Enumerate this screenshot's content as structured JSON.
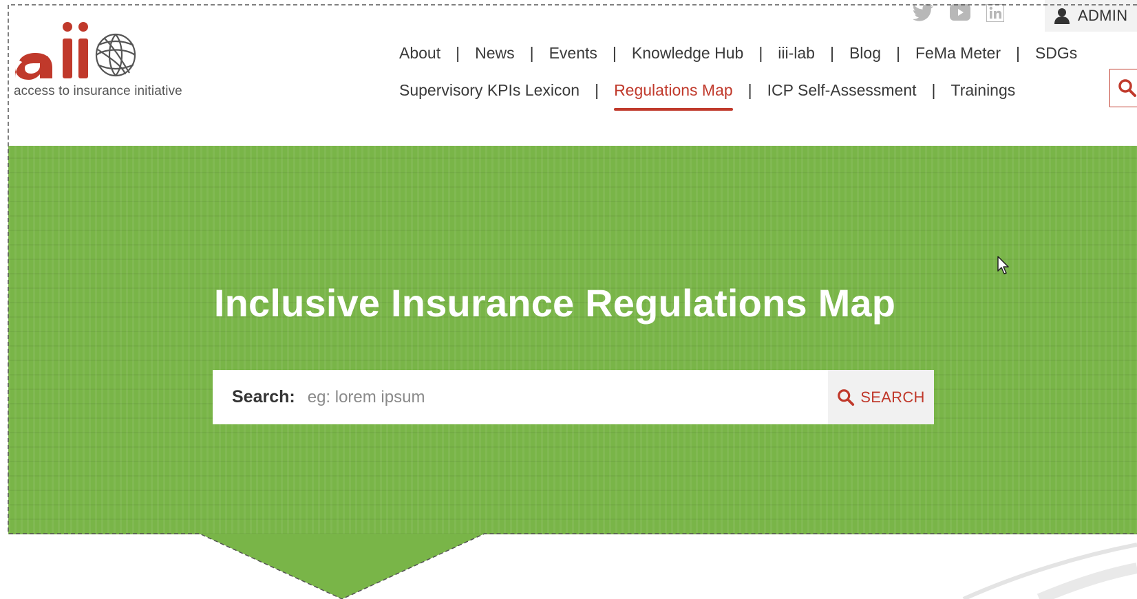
{
  "brand": {
    "logo_text": "aii",
    "tagline": "access to insurance initiative"
  },
  "social": {
    "icons": [
      "twitter-icon",
      "youtube-icon",
      "linkedin-icon"
    ]
  },
  "user": {
    "label": "ADMIN"
  },
  "nav": {
    "row1": [
      "About",
      "News",
      "Events",
      "Knowledge Hub",
      "iii-lab",
      "Blog",
      "FeMa Meter",
      "SDGs"
    ],
    "row2": [
      "Supervisory KPIs Lexicon",
      "Regulations Map",
      "ICP Self-Assessment",
      "Trainings"
    ],
    "active": "Regulations Map"
  },
  "hero": {
    "title": "Inclusive Insurance Regulations Map",
    "search_label": "Search:",
    "search_placeholder": "eg: lorem ipsum",
    "search_button": "SEARCH"
  },
  "colors": {
    "brand_red": "#c0392b",
    "hero_green": "#79b548"
  }
}
